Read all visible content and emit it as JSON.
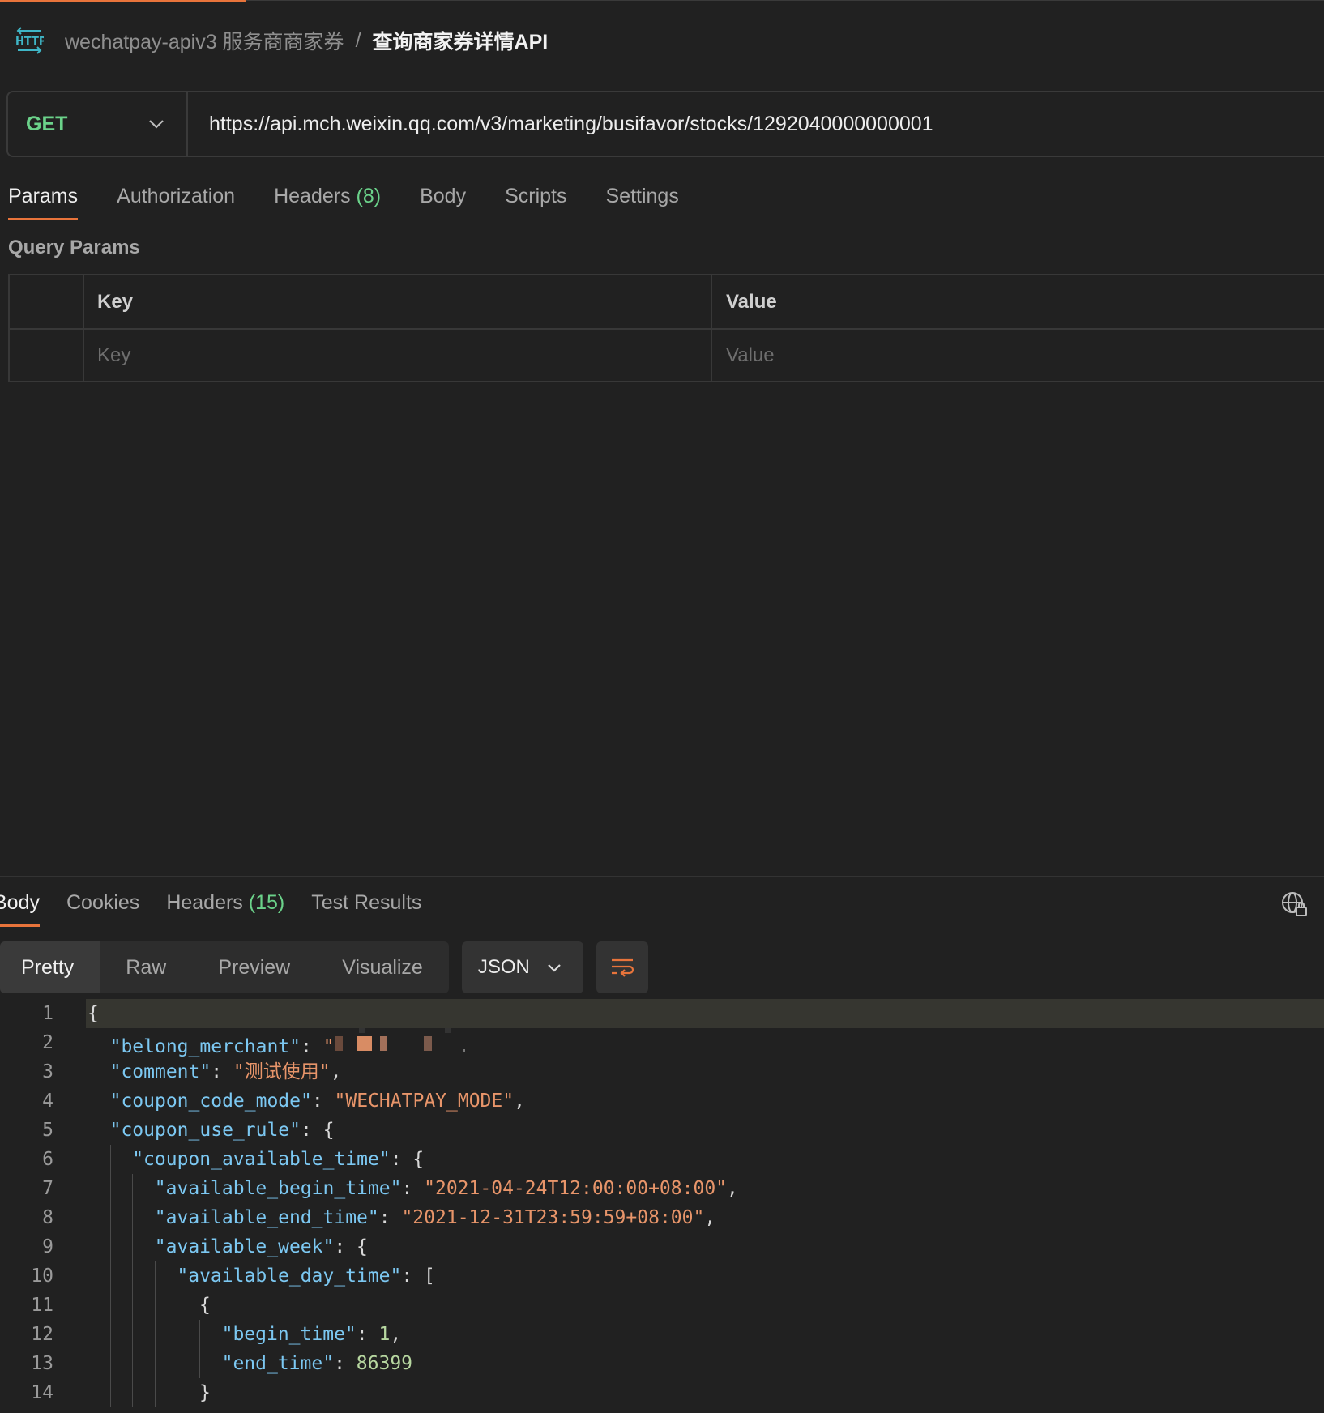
{
  "breadcrumb": {
    "icon": "http-icon",
    "collection": "wechatpay-apiv3 服务商商家券",
    "separator": "/",
    "request": "查询商家券详情API"
  },
  "request": {
    "method": "GET",
    "url": "https://api.mch.weixin.qq.com/v3/marketing/busifavor/stocks/1292040000000001"
  },
  "request_tabs": [
    {
      "label": "Params",
      "active": true
    },
    {
      "label": "Authorization"
    },
    {
      "label": "Headers",
      "count": "(8)"
    },
    {
      "label": "Body"
    },
    {
      "label": "Scripts"
    },
    {
      "label": "Settings"
    }
  ],
  "params": {
    "title": "Query Params",
    "columns": [
      "Key",
      "Value"
    ],
    "placeholders": {
      "key": "Key",
      "value": "Value"
    }
  },
  "response_tabs": [
    {
      "label": "Body",
      "active": true
    },
    {
      "label": "Cookies"
    },
    {
      "label": "Headers",
      "count": "(15)"
    },
    {
      "label": "Test Results"
    }
  ],
  "view_modes": [
    "Pretty",
    "Raw",
    "Preview",
    "Visualize"
  ],
  "format": "JSON",
  "code_lines": [
    {
      "n": "1",
      "indent": 0,
      "tokens": [
        [
          "p",
          "{"
        ]
      ]
    },
    {
      "n": "2",
      "indent": 1,
      "tokens": [
        [
          "k",
          "\"belong_merchant\""
        ],
        [
          "p",
          ": "
        ],
        [
          "s",
          "\""
        ]
      ],
      "redacted": true
    },
    {
      "n": "3",
      "indent": 1,
      "tokens": [
        [
          "k",
          "\"comment\""
        ],
        [
          "p",
          ": "
        ],
        [
          "s",
          "\"测试使用\""
        ],
        [
          "p",
          ","
        ]
      ]
    },
    {
      "n": "4",
      "indent": 1,
      "tokens": [
        [
          "k",
          "\"coupon_code_mode\""
        ],
        [
          "p",
          ": "
        ],
        [
          "s",
          "\"WECHATPAY_MODE\""
        ],
        [
          "p",
          ","
        ]
      ]
    },
    {
      "n": "5",
      "indent": 1,
      "tokens": [
        [
          "k",
          "\"coupon_use_rule\""
        ],
        [
          "p",
          ": {"
        ]
      ]
    },
    {
      "n": "6",
      "indent": 2,
      "tokens": [
        [
          "k",
          "\"coupon_available_time\""
        ],
        [
          "p",
          ": {"
        ]
      ]
    },
    {
      "n": "7",
      "indent": 3,
      "tokens": [
        [
          "k",
          "\"available_begin_time\""
        ],
        [
          "p",
          ": "
        ],
        [
          "s",
          "\"2021-04-24T12:00:00+08:00\""
        ],
        [
          "p",
          ","
        ]
      ]
    },
    {
      "n": "8",
      "indent": 3,
      "tokens": [
        [
          "k",
          "\"available_end_time\""
        ],
        [
          "p",
          ": "
        ],
        [
          "s",
          "\"2021-12-31T23:59:59+08:00\""
        ],
        [
          "p",
          ","
        ]
      ]
    },
    {
      "n": "9",
      "indent": 3,
      "tokens": [
        [
          "k",
          "\"available_week\""
        ],
        [
          "p",
          ": {"
        ]
      ]
    },
    {
      "n": "10",
      "indent": 4,
      "tokens": [
        [
          "k",
          "\"available_day_time\""
        ],
        [
          "p",
          ": ["
        ]
      ]
    },
    {
      "n": "11",
      "indent": 5,
      "tokens": [
        [
          "p",
          "{"
        ]
      ]
    },
    {
      "n": "12",
      "indent": 6,
      "tokens": [
        [
          "k",
          "\"begin_time\""
        ],
        [
          "p",
          ": "
        ],
        [
          "n",
          "1"
        ],
        [
          "p",
          ","
        ]
      ]
    },
    {
      "n": "13",
      "indent": 6,
      "tokens": [
        [
          "k",
          "\"end_time\""
        ],
        [
          "p",
          ": "
        ],
        [
          "n",
          "86399"
        ]
      ]
    },
    {
      "n": "14",
      "indent": 5,
      "tokens": [
        [
          "p",
          "}"
        ]
      ]
    }
  ],
  "colors": {
    "accent": "#e8743b",
    "method_get": "#6bd28a",
    "json_key": "#7cc8f2",
    "json_string": "#e8956a",
    "json_number": "#b7d7a0"
  }
}
